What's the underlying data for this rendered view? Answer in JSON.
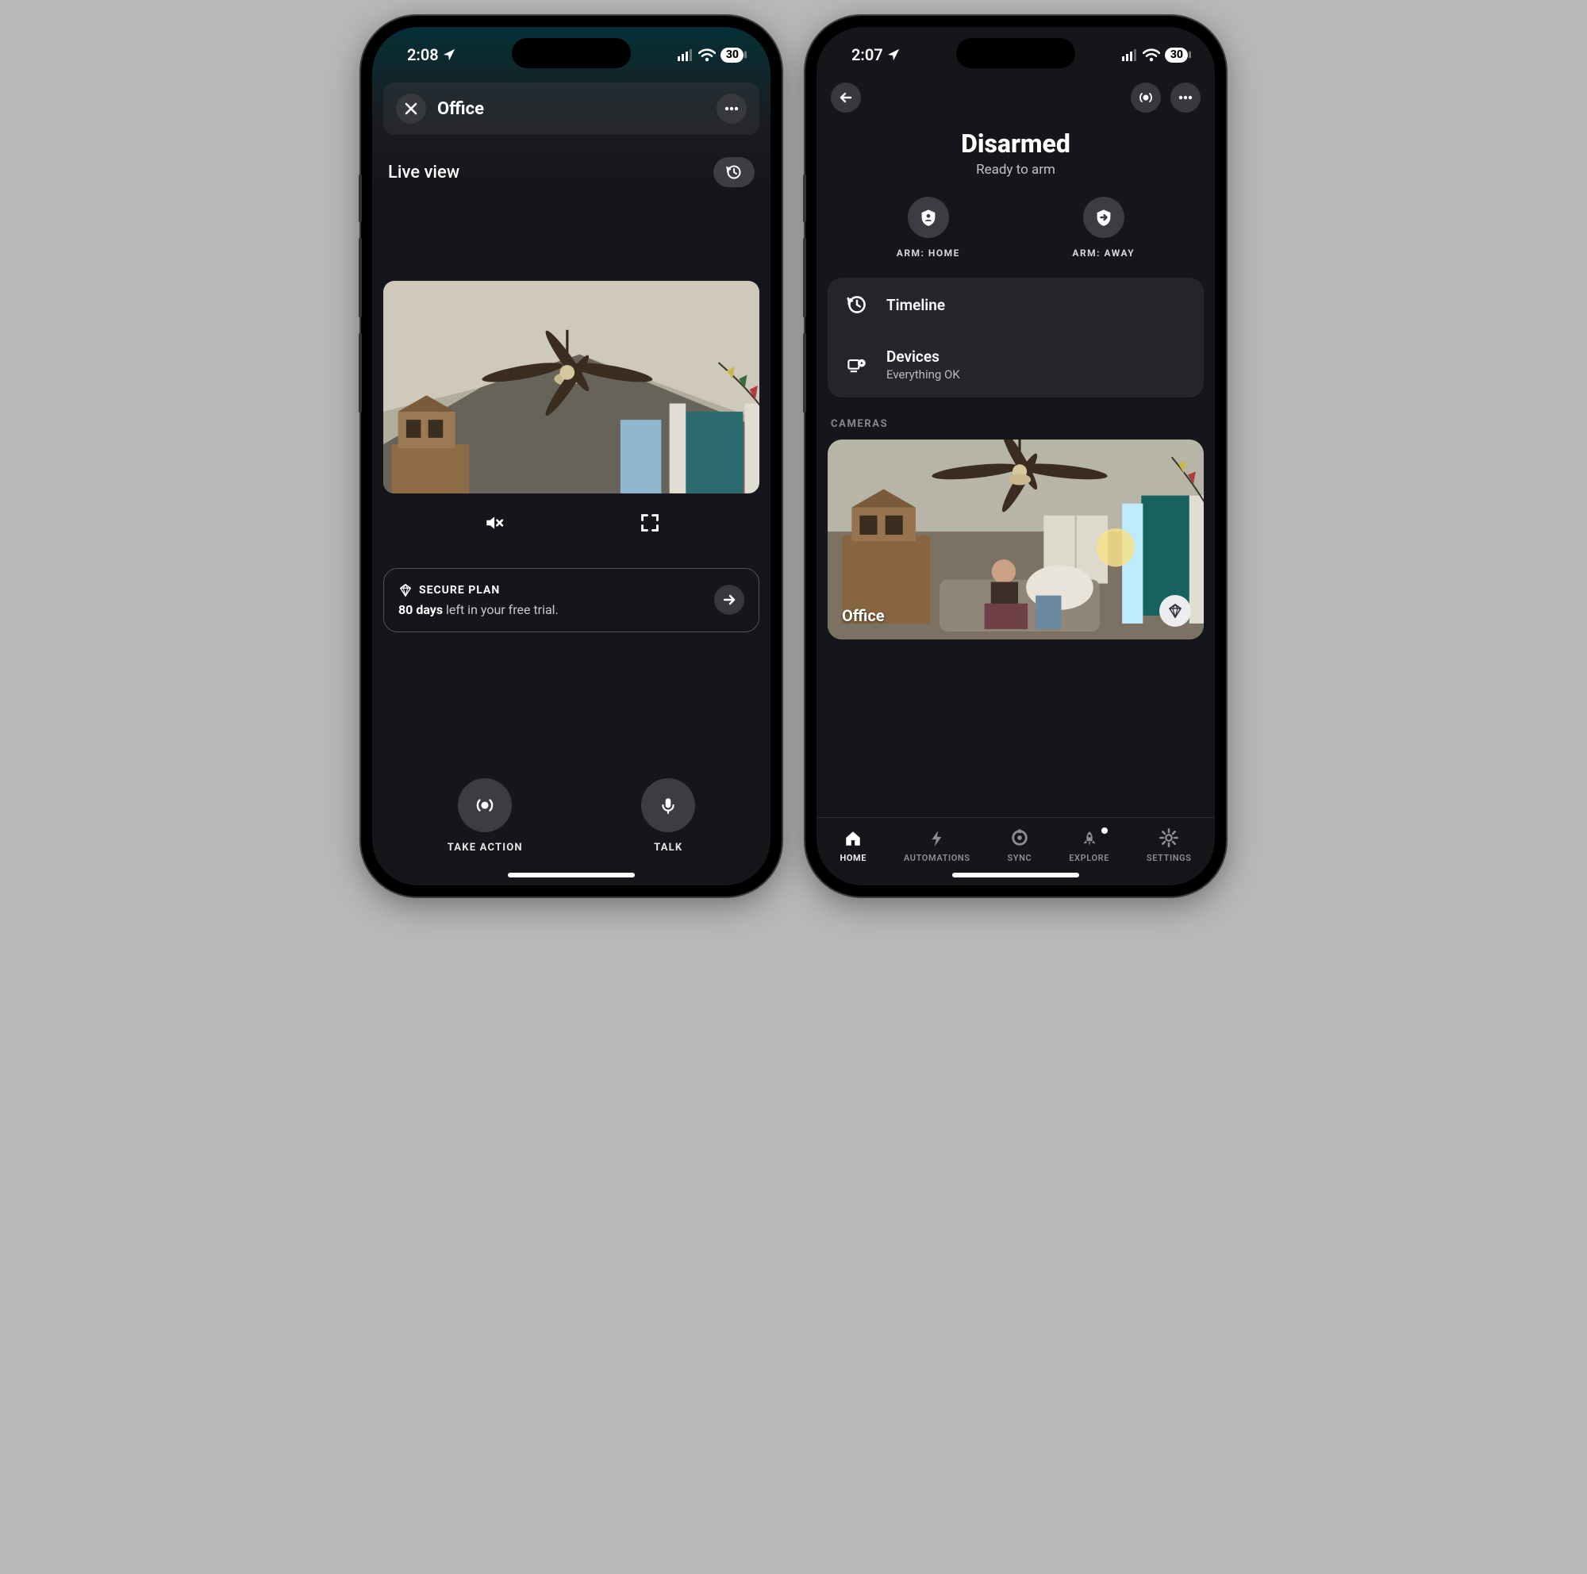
{
  "left": {
    "status": {
      "time": "2:08",
      "battery": "30"
    },
    "header": {
      "title": "Office"
    },
    "live_view_label": "Live view",
    "plan": {
      "title": "SECURE PLAN",
      "days": "80 days",
      "remainder": " left in your free trial."
    },
    "actions": {
      "take_action": "TAKE ACTION",
      "talk": "TALK"
    }
  },
  "right": {
    "status": {
      "time": "2:07",
      "battery": "30"
    },
    "armed": {
      "title": "Disarmed",
      "subtitle": "Ready to arm"
    },
    "arm_home": "ARM: HOME",
    "arm_away": "ARM: AWAY",
    "menu": {
      "timeline": "Timeline",
      "devices_title": "Devices",
      "devices_sub": "Everything OK"
    },
    "cameras_label": "CAMERAS",
    "camera_name": "Office",
    "tabs": {
      "home": "HOME",
      "automations": "AUTOMATIONS",
      "sync": "SYNC",
      "explore": "EXPLORE",
      "settings": "SETTINGS"
    }
  }
}
